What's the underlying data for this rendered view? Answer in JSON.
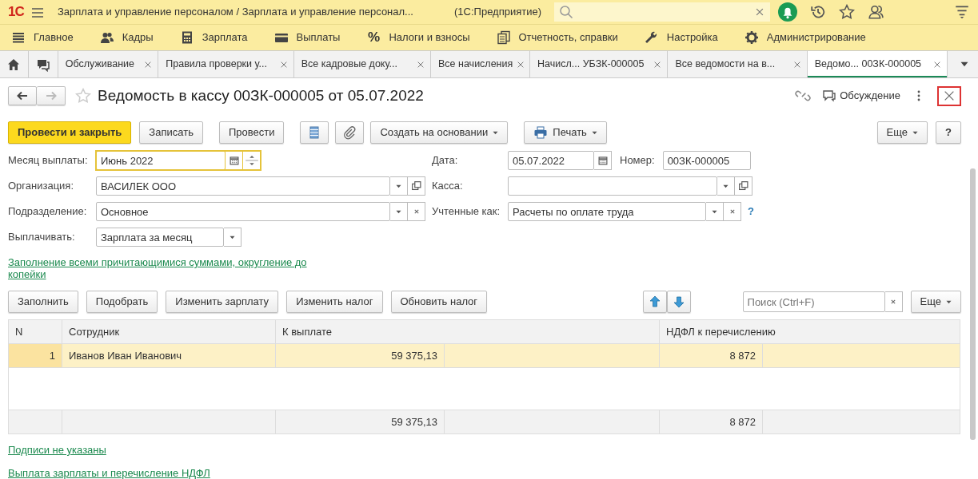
{
  "window": {
    "logo": "1С",
    "title": "Зарплата и управление персоналом / Зарплата и управление персонал...",
    "suffix": "(1С:Предприятие)"
  },
  "sections": [
    {
      "label": "Главное"
    },
    {
      "label": "Кадры"
    },
    {
      "label": "Зарплата"
    },
    {
      "label": "Выплаты"
    },
    {
      "label": "Налоги и взносы",
      "glyph": "%"
    },
    {
      "label": "Отчетность, справки"
    },
    {
      "label": "Настройка"
    },
    {
      "label": "Администрирование"
    }
  ],
  "tabs": [
    {
      "label": "Обслуживание",
      "selected": false
    },
    {
      "label": "Правила проверки у...",
      "selected": false
    },
    {
      "label": "Все кадровые доку...",
      "selected": false
    },
    {
      "label": "Все начисления",
      "selected": false
    },
    {
      "label": "Начисл... УБЗК-000005",
      "selected": false
    },
    {
      "label": "Все ведомости на в...",
      "selected": false
    },
    {
      "label": "Ведомо... 00ЗК-000005",
      "selected": true
    }
  ],
  "form": {
    "title": "Ведомость в кассу 00ЗК-000005 от 05.07.2022",
    "discussion": "Обсуждение",
    "toolbar": [
      {
        "kind": "primary",
        "label": "Провести и закрыть"
      },
      {
        "kind": "plain",
        "label": "Записать"
      },
      {
        "kind": "plain",
        "label": "Провести"
      },
      {
        "kind": "icon"
      },
      {
        "kind": "icon"
      },
      {
        "kind": "menu",
        "label": "Создать на основании"
      },
      {
        "kind": "print",
        "label": "Печать"
      }
    ],
    "more": "Еще",
    "help": "?",
    "fields_left": [
      {
        "label": "Месяц выплаты:",
        "value": "Июнь 2022",
        "focused": true
      },
      {
        "label": "Организация:",
        "value": "ВАСИЛЕК ООО",
        "focused": false
      },
      {
        "label": "Подразделение:",
        "value": "Основное",
        "focused": false
      },
      {
        "label": "Выплачивать:",
        "value": "Зарплата за месяц",
        "focused": false
      }
    ],
    "date": {
      "label": "Дата:",
      "value": "05.07.2022"
    },
    "number": {
      "label": "Номер:",
      "value": "00ЗК-000005"
    },
    "fields_right": [
      {
        "label": "Касса:",
        "focused": false
      },
      {
        "label": "Учтенные как:",
        "value": "Расчеты по оплате труда",
        "focused": false,
        "help": "?"
      }
    ],
    "fill_link": "Заполнение всеми причитающимися суммами, округление до копейки",
    "table_toolbar": [
      "Заполнить",
      "Подобрать",
      "Изменить зарплату",
      "Изменить налог",
      "Обновить налог"
    ],
    "search": {
      "placeholder": "Поиск (Ctrl+F)"
    },
    "table_more": "Еще",
    "table": {
      "columns": [
        "N",
        "Сотрудник",
        "К выплате",
        "НДФЛ к перечислению"
      ],
      "rows": [
        {
          "n": "1",
          "employee": "Иванов Иван Иванович",
          "to_pay": "59 375,13",
          "ndfl": "8 872",
          "selected": true
        }
      ],
      "totals": {
        "to_pay": "59 375,13",
        "ndfl": "8 872"
      }
    },
    "links": [
      "Подписи не указаны",
      "Выплата зарплаты и перечисление НДФЛ"
    ]
  }
}
